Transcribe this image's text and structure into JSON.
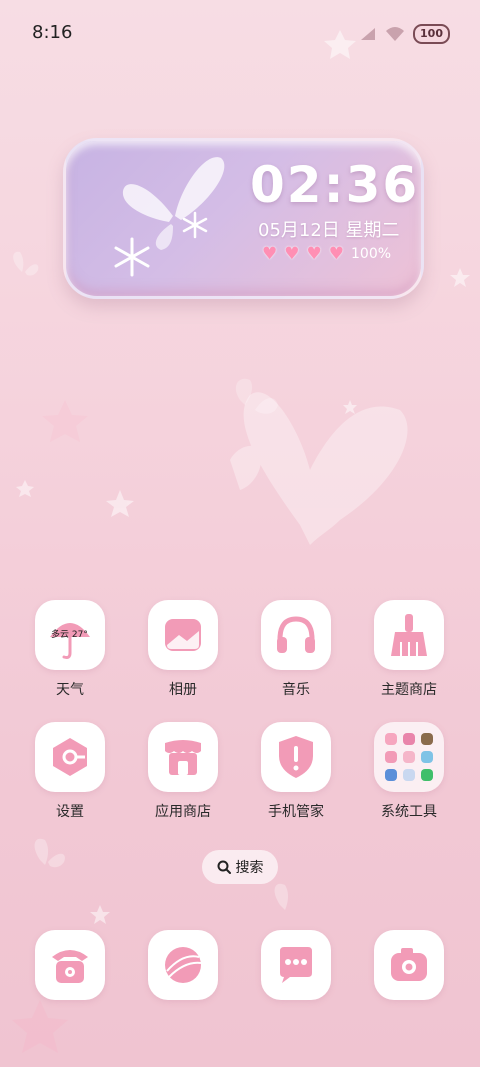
{
  "status_bar": {
    "time": "8:16",
    "battery": "100"
  },
  "widget": {
    "time": "02:36",
    "date": "05月12日  星期二",
    "battery_percent": "100%"
  },
  "apps": [
    {
      "label": "天气",
      "icon": "umbrella-icon",
      "badge": "多云 27°"
    },
    {
      "label": "相册",
      "icon": "picture-icon"
    },
    {
      "label": "音乐",
      "icon": "headphones-icon"
    },
    {
      "label": "主题商店",
      "icon": "brush-icon"
    },
    {
      "label": "设置",
      "icon": "gear-icon"
    },
    {
      "label": "应用商店",
      "icon": "store-icon"
    },
    {
      "label": "手机管家",
      "icon": "shield-icon"
    },
    {
      "label": "系统工具",
      "icon": "folder-icon"
    }
  ],
  "search": {
    "label": "搜索"
  },
  "dock": [
    {
      "icon": "phone-icon"
    },
    {
      "icon": "browser-icon"
    },
    {
      "icon": "message-icon"
    },
    {
      "icon": "camera-icon"
    }
  ],
  "colors": {
    "accent": "#f29bb7",
    "background": "#f6d6df"
  }
}
